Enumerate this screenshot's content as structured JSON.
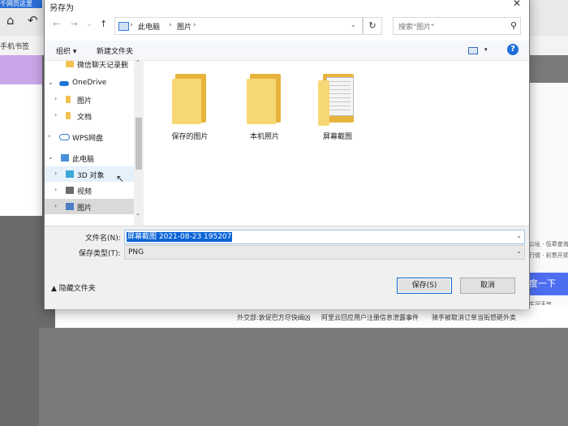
{
  "background": {
    "tab_text": "千网页这里",
    "bookmark_label": "手机书签",
    "right_button": "度一下",
    "right_snippets": [
      "公址 · 伍章查询",
      "行情 · 彩票开奖",
      "实况天气"
    ],
    "news_items": [
      "外交部:敦促巴方尽快缉凶",
      "阿里云回应用户注册信息泄露事件",
      "骑手被取消订单当街怒砸外卖"
    ]
  },
  "dialog": {
    "title": "另存为",
    "close_glyph": "✕",
    "address": {
      "crumbs": [
        "此电脑",
        "图片"
      ],
      "separator": "›"
    },
    "search_placeholder": "搜索\"图片\"",
    "toolbar": {
      "organize": "组织 ▾",
      "new_folder": "新建文件夹"
    },
    "tree": [
      {
        "label": "微信聊天记录删",
        "icon": "folder",
        "indent": 2
      },
      {
        "label": "OneDrive",
        "icon": "cloud",
        "indent": 0,
        "expanded": true
      },
      {
        "label": "图片",
        "icon": "folder",
        "indent": 1
      },
      {
        "label": "文档",
        "icon": "folder",
        "indent": 1
      },
      {
        "label": "WPS网盘",
        "icon": "wps-cloud",
        "indent": 0
      },
      {
        "label": "此电脑",
        "icon": "computer",
        "indent": 0,
        "expanded": true
      },
      {
        "label": "3D 对象",
        "icon": "cube",
        "indent": 1,
        "hovered": true
      },
      {
        "label": "视频",
        "icon": "video",
        "indent": 1
      },
      {
        "label": "图片",
        "icon": "picture",
        "indent": 1,
        "selected": true
      }
    ],
    "folders": [
      {
        "label": "保存的图片",
        "type": "plain"
      },
      {
        "label": "本机照片",
        "type": "plain"
      },
      {
        "label": "屏幕截图",
        "type": "documents"
      }
    ],
    "filename_label": "文件名(N):",
    "filename_value": "屏幕截图 2021-08-23 195207",
    "filetype_label": "保存类型(T):",
    "filetype_value": "PNG",
    "hide_folders": "▲ 隐藏文件夹",
    "save_button": "保存(S)",
    "cancel_button": "取消"
  }
}
